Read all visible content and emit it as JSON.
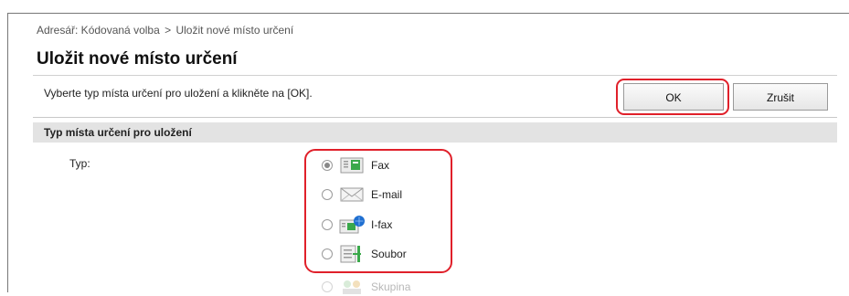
{
  "breadcrumb": {
    "item1": "Adresář: Kódovaná volba",
    "separator": ">",
    "item2": "Uložit nové místo určení"
  },
  "page": {
    "title": "Uložit nové místo určení",
    "instruction": "Vyberte typ místa určení pro uložení a klikněte na [OK]."
  },
  "buttons": {
    "ok_label": "OK",
    "cancel_label": "Zrušit"
  },
  "section": {
    "header": "Typ místa určení pro uložení",
    "field_label": "Typ:"
  },
  "types": {
    "selected": "Fax",
    "options": [
      {
        "label": "Fax",
        "icon": "fax-icon",
        "checked": true
      },
      {
        "label": "E-mail",
        "icon": "email-icon",
        "checked": false
      },
      {
        "label": "I-fax",
        "icon": "ifax-icon",
        "checked": false
      },
      {
        "label": "Soubor",
        "icon": "file-icon",
        "checked": false
      },
      {
        "label": "Skupina",
        "icon": "group-icon",
        "checked": false,
        "disabled": true
      }
    ]
  },
  "colors": {
    "highlight": "#e0202a",
    "section_bg": "#e3e3e3",
    "icon_green": "#3aa84a",
    "icon_blue": "#1f6fd1"
  }
}
